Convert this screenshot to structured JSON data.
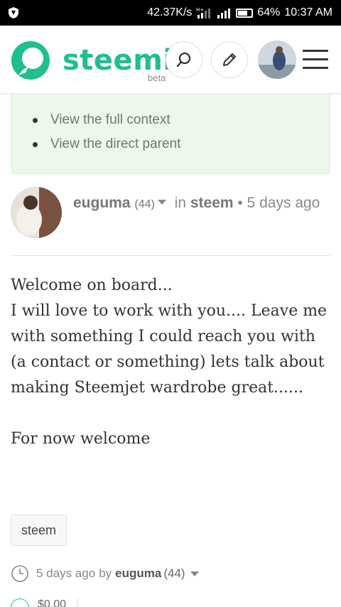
{
  "status_bar": {
    "speed": "42.37K/s",
    "network_type": "H+",
    "battery_percent": "64%",
    "battery_level": 0.64,
    "time": "10:37 AM"
  },
  "header": {
    "logo_text": "steemit",
    "logo_beta": "beta",
    "brand_color": "#1fbf8f"
  },
  "context_links": [
    "View the full context",
    "View the direct parent"
  ],
  "author": {
    "name": "euguma",
    "reputation": "(44)",
    "in_label": "in",
    "category": "steem",
    "separator": "•",
    "time_ago": "5 days ago"
  },
  "comment": {
    "lines": [
      "Welcome on board...",
      "I will love to work with you.... Leave me with something I could reach you with (a contact or something) lets talk about making Steemjet wardrobe great......"
    ],
    "closing": "For now welcome"
  },
  "tag": "steem",
  "footer": {
    "time_ago": "5 days ago",
    "by_label": "by",
    "author": "euguma",
    "reputation": "(44)"
  },
  "payout": "$0.00",
  "icons": {
    "status_left": "shield-icon",
    "search": "search-icon",
    "edit": "pencil-icon",
    "menu": "hamburger-icon",
    "clock": "clock-icon",
    "upvote": "upvote-icon"
  }
}
